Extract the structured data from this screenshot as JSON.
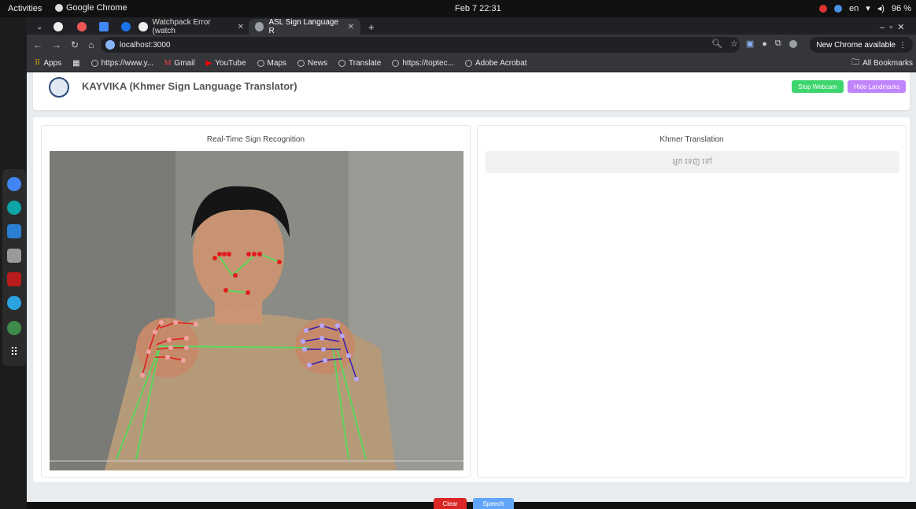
{
  "system": {
    "activities": "Activities",
    "app_name": "Google Chrome",
    "clock": "Feb 7  22:31",
    "lang": "en",
    "battery": "96 %"
  },
  "tabs": [
    {
      "label": "Watchpack Error (watch"
    },
    {
      "label": "ASL Sign Language R"
    }
  ],
  "omnibox": {
    "url": "localhost:3000"
  },
  "update_button": "New Chrome available",
  "bookmarks": {
    "apps": "Apps",
    "items": [
      "https://www.y...",
      "Gmail",
      "YouTube",
      "Maps",
      "News",
      "Translate",
      "https://toptec...",
      "Adobe Acrobat"
    ],
    "all": "All Bookmarks"
  },
  "app": {
    "title": "KAYVIKA (Khmer Sign Language Translator)",
    "stop_webcam": "Stop Webcam",
    "hide_landmarks": "Hide Landmarks",
    "left_title": "Real-Time Sign Recognition",
    "right_title": "Khmer Translation",
    "translation_text": "អ្នក ទេញ ទៅ",
    "clear": "Clear",
    "speech": "Speech"
  },
  "colors": {
    "stop_webcam": "#3dd56d",
    "hide_landmarks": "#c084fc",
    "clear": "#dc2626",
    "speech": "#60a5fa"
  }
}
